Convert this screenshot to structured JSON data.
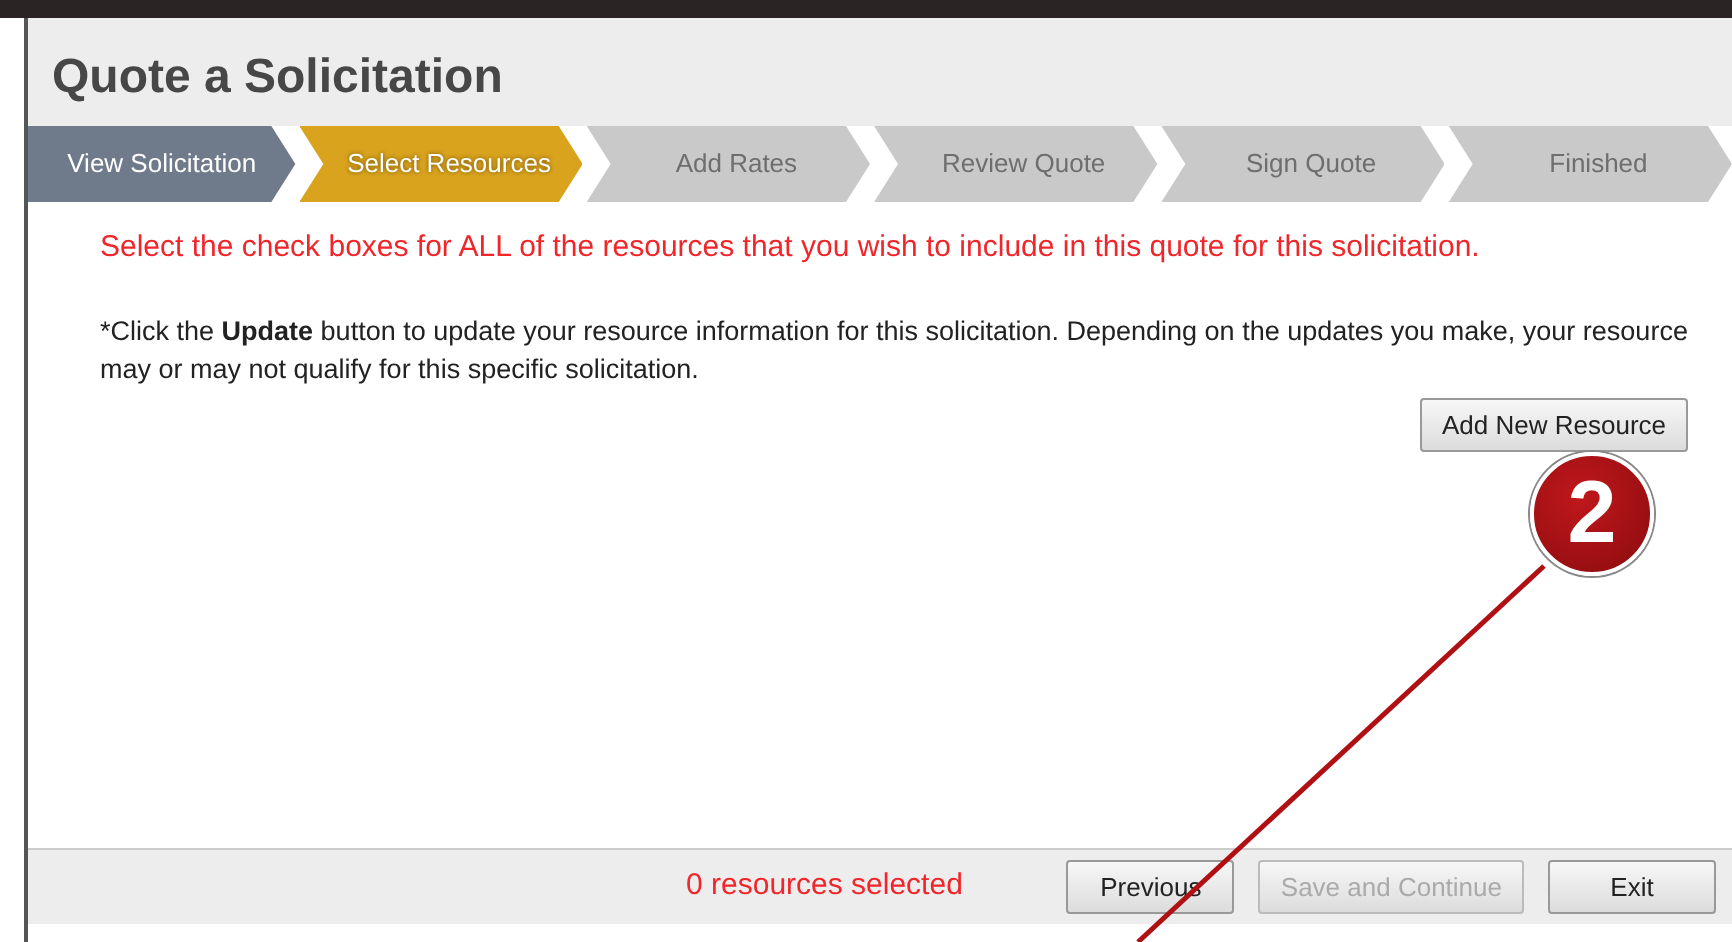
{
  "window": {
    "title": "Quote a Solicitation"
  },
  "steps": [
    {
      "label": "View Solicitation",
      "selected": false,
      "completed": true
    },
    {
      "label": "Select Resources",
      "selected": true,
      "completed": false
    },
    {
      "label": "Add Rates",
      "selected": false,
      "completed": false
    },
    {
      "label": "Review Quote",
      "selected": false,
      "completed": false
    },
    {
      "label": "Sign Quote",
      "selected": false,
      "completed": false
    },
    {
      "label": "Finished",
      "selected": false,
      "completed": false
    }
  ],
  "instruction": "Select the check boxes for ALL of the resources that you wish to include in this quote for this solicitation.",
  "note": "*Click the **Update** button to update your resource information for this solicitation. Depending on the updates you make, your resource may or may not qualify for this specific solicitation.",
  "add_button": {
    "label": "Add New Resource",
    "disabled": false
  },
  "footer": {
    "status": "0 resources selected",
    "buttons": [
      {
        "label": "Previous",
        "disabled": false
      },
      {
        "label": "Save and Continue",
        "disabled": true
      },
      {
        "label": "Exit",
        "disabled": false
      }
    ]
  },
  "callout": {
    "number": "2"
  }
}
